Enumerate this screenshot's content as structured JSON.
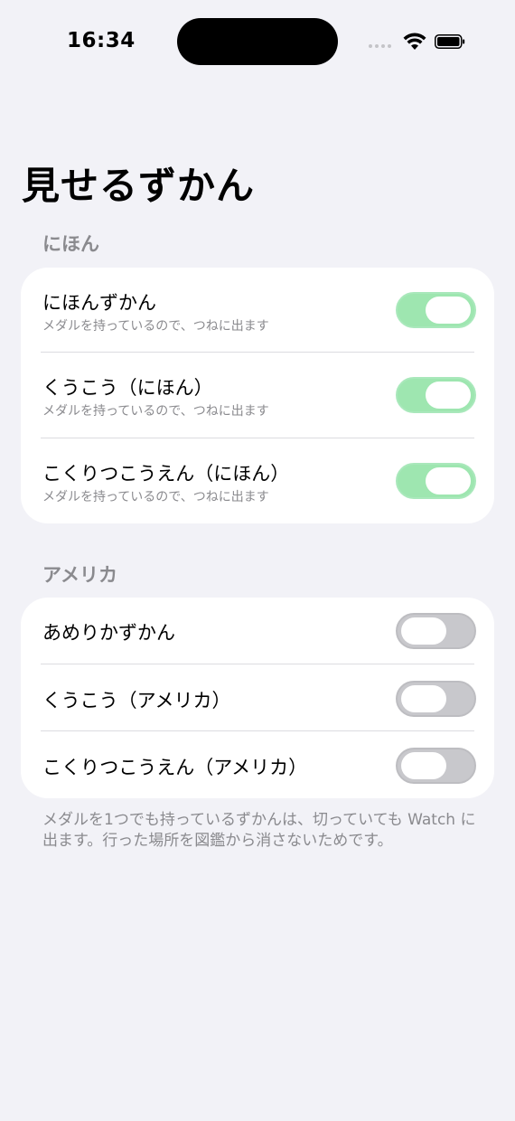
{
  "status_bar": {
    "time": "16:34"
  },
  "title": "見せるずかん",
  "sections": [
    {
      "header": "にほん",
      "rows": [
        {
          "title": "にほんずかん",
          "subtitle": "メダルを持っているので、つねに出ます",
          "toggle": true
        },
        {
          "title": "くうこう（にほん）",
          "subtitle": "メダルを持っているので、つねに出ます",
          "toggle": true
        },
        {
          "title": "こくりつこうえん（にほん）",
          "subtitle": "メダルを持っているので、つねに出ます",
          "toggle": true
        }
      ]
    },
    {
      "header": "アメリカ",
      "rows": [
        {
          "title": "あめりかずかん",
          "toggle": false
        },
        {
          "title": "くうこう（アメリカ）",
          "toggle": false
        },
        {
          "title": "こくりつこうえん（アメリカ）",
          "toggle": false
        }
      ]
    }
  ],
  "footer": "メダルを1つでも持っているずかんは、切っていても Watch に出ます。行った場所を図鑑から消さないためです。",
  "colors": {
    "background": "#f2f2f7",
    "toggle_on": "#9ee6b0",
    "toggle_off": "#c8c8cc",
    "secondary_text": "#8a8a8e"
  },
  "icons": [
    "cellular-signal-icon",
    "wifi-icon",
    "battery-icon"
  ]
}
